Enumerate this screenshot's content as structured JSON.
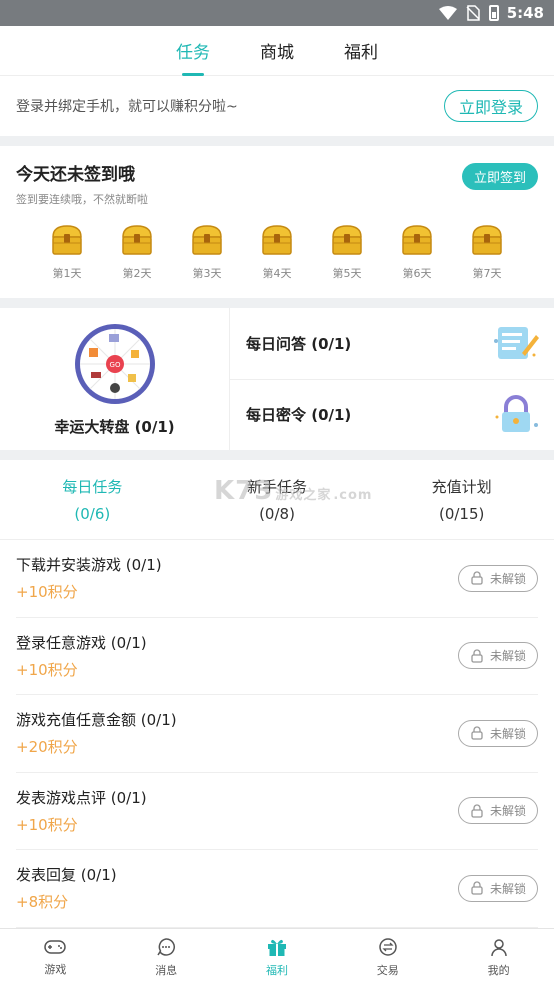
{
  "status_bar": {
    "time": "5:48"
  },
  "top_tabs": [
    {
      "label": "任务",
      "active": true
    },
    {
      "label": "商城",
      "active": false
    },
    {
      "label": "福利",
      "active": false
    }
  ],
  "login_prompt": {
    "text": "登录并绑定手机，就可以赚积分啦~",
    "button": "立即登录"
  },
  "signin": {
    "title": "今天还未签到哦",
    "subtitle": "签到要连续哦，不然就断啦",
    "button": "立即签到",
    "days": [
      "第1天",
      "第2天",
      "第3天",
      "第4天",
      "第5天",
      "第6天",
      "第7天"
    ]
  },
  "features": {
    "wheel_label": "幸运大转盘 (0/1)",
    "daily_qa": "每日问答 (0/1)",
    "daily_password": "每日密令 (0/1)",
    "wheel_center": "GO"
  },
  "task_tabs": [
    {
      "label": "每日任务",
      "count": "(0/6)",
      "active": true
    },
    {
      "label": "新手任务",
      "count": "(0/8)",
      "active": false
    },
    {
      "label": "充值计划",
      "count": "(0/15)",
      "active": false
    }
  ],
  "watermark": {
    "main": "K73",
    "sub": "游戏之家",
    "domain": ".com"
  },
  "tasks": [
    {
      "title": "下载并安装游戏 (0/1)",
      "points": "+10积分",
      "status": "未解锁"
    },
    {
      "title": "登录任意游戏 (0/1)",
      "points": "+10积分",
      "status": "未解锁"
    },
    {
      "title": "游戏充值任意金额 (0/1)",
      "points": "+20积分",
      "status": "未解锁"
    },
    {
      "title": "发表游戏点评 (0/1)",
      "points": "+10积分",
      "status": "未解锁"
    },
    {
      "title": "发表回复 (0/1)",
      "points": "+8积分",
      "status": "未解锁"
    }
  ],
  "bottom_nav": [
    {
      "label": "游戏",
      "icon": "gamepad-icon",
      "active": false
    },
    {
      "label": "消息",
      "icon": "chat-icon",
      "active": false
    },
    {
      "label": "福利",
      "icon": "gift-icon",
      "active": true
    },
    {
      "label": "交易",
      "icon": "exchange-icon",
      "active": false
    },
    {
      "label": "我的",
      "icon": "user-icon",
      "active": false
    }
  ],
  "colors": {
    "accent": "#1fb8b4",
    "points": "#f0a64a",
    "gold": "#e8b324"
  }
}
